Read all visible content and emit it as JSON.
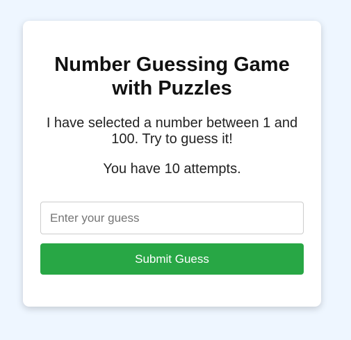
{
  "game": {
    "title": "Number Guessing Game with Puzzles",
    "intro": "I have selected a number between 1 and 100. Try to guess it!",
    "attempts_text": "You have 10 attempts.",
    "guess_placeholder": "Enter your guess",
    "guess_value": "",
    "submit_label": "Submit Guess"
  },
  "colors": {
    "background": "#eef6ff",
    "card": "#ffffff",
    "submit_button": "#28a745",
    "submit_text": "#ffffff"
  }
}
